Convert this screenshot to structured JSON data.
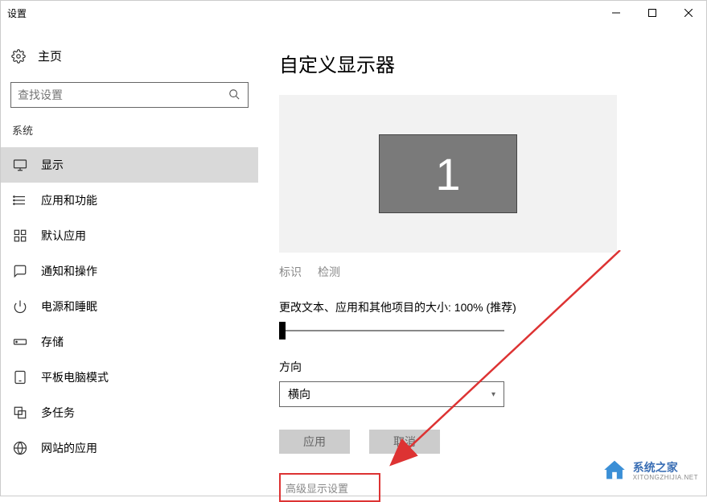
{
  "window": {
    "title": "设置"
  },
  "sidebar": {
    "home_label": "主页",
    "search_placeholder": "查找设置",
    "section_label": "系统",
    "items": [
      {
        "label": "显示"
      },
      {
        "label": "应用和功能"
      },
      {
        "label": "默认应用"
      },
      {
        "label": "通知和操作"
      },
      {
        "label": "电源和睡眠"
      },
      {
        "label": "存储"
      },
      {
        "label": "平板电脑模式"
      },
      {
        "label": "多任务"
      },
      {
        "label": "网站的应用"
      }
    ]
  },
  "main": {
    "heading": "自定义显示器",
    "monitor_number": "1",
    "identify_label": "标识",
    "detect_label": "检测",
    "scale_label": "更改文本、应用和其他项目的大小: 100% (推荐)",
    "orientation_label": "方向",
    "orientation_value": "横向",
    "apply_label": "应用",
    "cancel_label": "取消",
    "advanced_link": "高级显示设置"
  },
  "watermark": {
    "name": "系统之家",
    "url": "XITONGZHIJIA.NET"
  }
}
